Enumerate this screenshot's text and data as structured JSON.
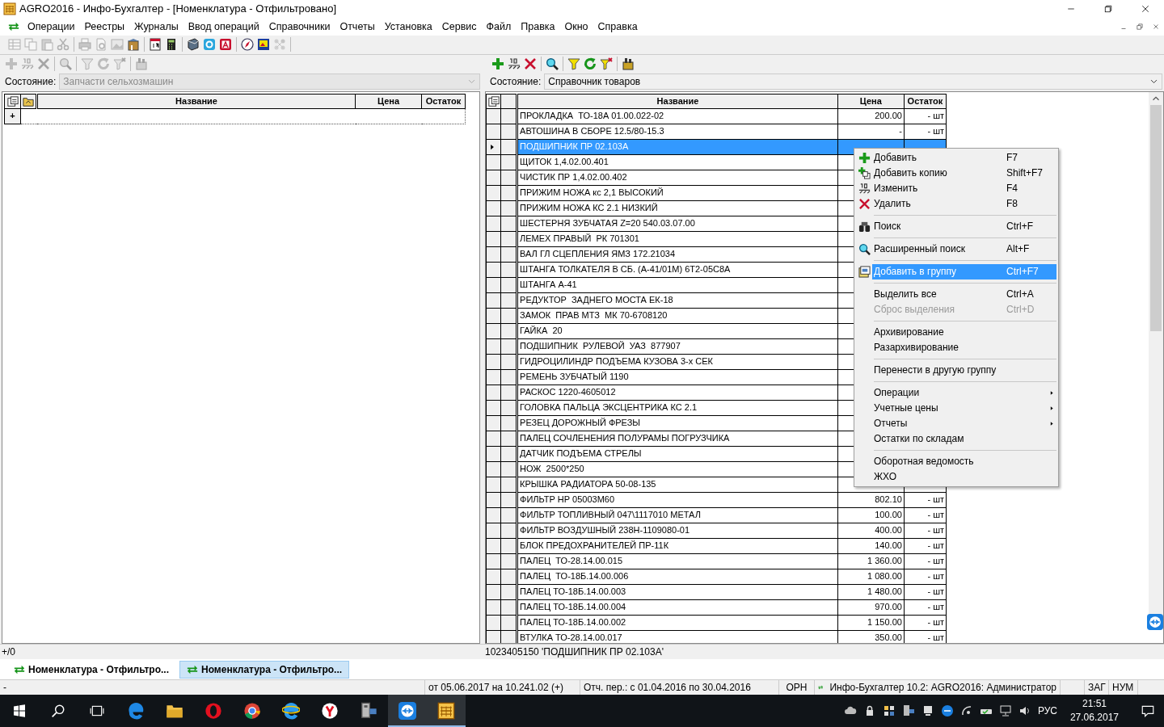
{
  "window": {
    "title": "AGRO2016 - Инфо-Бухгалтер - [Номенклатура - Отфильтровано]"
  },
  "menu": [
    "Операции",
    "Реестры",
    "Журналы",
    "Ввод операций",
    "Справочники",
    "Отчеты",
    "Установка",
    "Сервис",
    "Файл",
    "Правка",
    "Окно",
    "Справка"
  ],
  "left_panel": {
    "toolbar_enabled": false,
    "state_label": "Состояние:",
    "state_value": "Запчасти сельхозмашин",
    "state_disabled": true,
    "columns": [
      "Название",
      "Цена",
      "Остаток"
    ],
    "add_row": "+"
  },
  "right_panel": {
    "toolbar_enabled": true,
    "state_label": "Состояние:",
    "state_value": "Справочник товаров",
    "state_disabled": false,
    "columns": [
      "Название",
      "Цена",
      "Остаток"
    ],
    "rows": [
      {
        "name": "ПРОКЛАДКА  ТО-18А 01.00.022-02",
        "price": "200.00",
        "stock": "- шт",
        "selected": false
      },
      {
        "name": "АВТОШИНА В СБОРЕ 12.5/80-15.3",
        "price": "-",
        "stock": "- шт",
        "selected": false
      },
      {
        "name": "ПОДШИПНИК ПР 02.103А",
        "selected": true
      },
      {
        "name": "ЩИТОК 1,4.02.00.401",
        "selected": false
      },
      {
        "name": "ЧИСТИК ПР 1,4.02.00.402",
        "selected": false
      },
      {
        "name": "ПРИЖИМ НОЖА кс 2,1 ВЫСОКИЙ",
        "selected": false
      },
      {
        "name": "ПРИЖИМ НОЖА КС 2.1 НИЗКИЙ",
        "selected": false
      },
      {
        "name": "ШЕСТЕРНЯ ЗУБЧАТАЯ Z=20 540.03.07.00",
        "selected": false
      },
      {
        "name": "ЛЕМЕХ ПРАВЫЙ  РК 701301",
        "selected": false
      },
      {
        "name": "ВАЛ ГЛ СЦЕПЛЕНИЯ ЯМЗ 172.21034",
        "selected": false
      },
      {
        "name": "ШТАНГА ТОЛКАТЕЛЯ В СБ. (А-41/01М) 6Т2-05С8А",
        "selected": false
      },
      {
        "name": "ШТАНГА А-41",
        "selected": false
      },
      {
        "name": "РЕДУКТОР  ЗАДНЕГО МОСТА ЕК-18",
        "selected": false
      },
      {
        "name": "ЗАМОК  ПРАВ МТЗ  МК 70-6708120",
        "selected": false
      },
      {
        "name": "ГАЙКА  20",
        "selected": false
      },
      {
        "name": "ПОДШИПНИК  РУЛЕВОЙ  УАЗ  877907",
        "selected": false
      },
      {
        "name": "ГИДРОЦИЛИНДР ПОДЪЕМА КУЗОВА 3-х СЕК",
        "selected": false
      },
      {
        "name": "РЕМЕНЬ ЗУБЧАТЫЙ 1190",
        "selected": false
      },
      {
        "name": "РАСКОС 1220-4605012",
        "selected": false
      },
      {
        "name": "ГОЛОВКА ПАЛЬЦА ЭКСЦЕНТРИКА КС 2.1",
        "selected": false
      },
      {
        "name": "РЕЗЕЦ ДОРОЖНЫЙ ФРЕЗЫ",
        "selected": false
      },
      {
        "name": "ПАЛЕЦ СОЧЛЕНЕНИЯ ПОЛУРАМЫ ПОГРУЗЧИКА",
        "selected": false
      },
      {
        "name": "ДАТЧИК ПОДЪЕМА СТРЕЛЫ",
        "selected": false
      },
      {
        "name": "НОЖ  2500*250",
        "selected": false
      },
      {
        "name": "КРЫШКА РАДИАТОРА 50-08-135",
        "selected": false
      },
      {
        "name": "ФИЛЬТР НР 05003М60",
        "price": "802.10",
        "stock": "- шт",
        "selected": false
      },
      {
        "name": "ФИЛЬТР ТОПЛИВНЫЙ 047\\1117010 МЕТАЛ",
        "price": "100.00",
        "stock": "- шт",
        "selected": false
      },
      {
        "name": "ФИЛЬТР ВОЗДУШНЫЙ 238Н-1109080-01",
        "price": "400.00",
        "stock": "- шт",
        "selected": false
      },
      {
        "name": "БЛОК ПРЕДОХРАНИТЕЛЕЙ ПР-11К",
        "price": "140.00",
        "stock": "- шт",
        "selected": false
      },
      {
        "name": "ПАЛЕЦ  ТО-28.14.00.015",
        "price": "1 360.00",
        "stock": "- шт",
        "selected": false
      },
      {
        "name": "ПАЛЕЦ  ТО-18Б.14.00.006",
        "price": "1 080.00",
        "stock": "- шт",
        "selected": false
      },
      {
        "name": "ПАЛЕЦ ТО-18Б.14.00.003",
        "price": "1 480.00",
        "stock": "- шт",
        "selected": false
      },
      {
        "name": "ПАЛЕЦ ТО-18Б.14.00.004",
        "price": "970.00",
        "stock": "- шт",
        "selected": false
      },
      {
        "name": "ПАЛЕЦ ТО-18Б.14.00.002",
        "price": "1 150.00",
        "stock": "- шт",
        "selected": false
      },
      {
        "name": "ВТУЛКА ТО-28.14.00.017",
        "price": "350.00",
        "stock": "- шт",
        "selected": false
      }
    ]
  },
  "context_menu": [
    {
      "kind": "item",
      "label": "Добавить",
      "shortcut": "F7",
      "selected": false,
      "disabled": false,
      "submenu": false
    },
    {
      "kind": "item",
      "label": "Добавить копию",
      "shortcut": "Shift+F7",
      "selected": false,
      "disabled": false,
      "submenu": false
    },
    {
      "kind": "item",
      "label": "Изменить",
      "shortcut": "F4",
      "selected": false,
      "disabled": false,
      "submenu": false
    },
    {
      "kind": "item",
      "label": "Удалить",
      "shortcut": "F8",
      "selected": false,
      "disabled": false,
      "submenu": false
    },
    {
      "kind": "separator"
    },
    {
      "kind": "item",
      "label": "Поиск",
      "shortcut": "Ctrl+F",
      "selected": false,
      "disabled": false,
      "submenu": false
    },
    {
      "kind": "separator"
    },
    {
      "kind": "item",
      "label": "Расширенный поиск",
      "shortcut": "Alt+F",
      "selected": false,
      "disabled": false,
      "submenu": false
    },
    {
      "kind": "separator"
    },
    {
      "kind": "item",
      "label": "Добавить в группу",
      "shortcut": "Ctrl+F7",
      "selected": true,
      "disabled": false,
      "submenu": false
    },
    {
      "kind": "separator"
    },
    {
      "kind": "item",
      "label": "Выделить все",
      "shortcut": "Ctrl+A",
      "selected": false,
      "disabled": false,
      "submenu": false
    },
    {
      "kind": "item",
      "label": "Сброс выделения",
      "shortcut": "Ctrl+D",
      "selected": false,
      "disabled": true,
      "submenu": false
    },
    {
      "kind": "separator"
    },
    {
      "kind": "item",
      "label": "Архивирование",
      "selected": false,
      "disabled": false,
      "submenu": false
    },
    {
      "kind": "item",
      "label": "Разархивирование",
      "selected": false,
      "disabled": false,
      "submenu": false
    },
    {
      "kind": "separator"
    },
    {
      "kind": "item",
      "label": "Перенести в другую группу",
      "selected": false,
      "disabled": false,
      "submenu": false
    },
    {
      "kind": "separator"
    },
    {
      "kind": "item",
      "label": "Операции",
      "selected": false,
      "disabled": false,
      "submenu": true
    },
    {
      "kind": "item",
      "label": "Учетные цены",
      "selected": false,
      "disabled": false,
      "submenu": true
    },
    {
      "kind": "item",
      "label": "Отчеты",
      "selected": false,
      "disabled": false,
      "submenu": true
    },
    {
      "kind": "item",
      "label": "Остатки по складам",
      "selected": false,
      "disabled": false,
      "submenu": false
    },
    {
      "kind": "separator"
    },
    {
      "kind": "item",
      "label": "Оборотная ведомость",
      "selected": false,
      "disabled": false,
      "submenu": false
    },
    {
      "kind": "item",
      "label": "ЖХО",
      "selected": false,
      "disabled": false,
      "submenu": false
    }
  ],
  "info_bar": {
    "count": "+/0",
    "record": "1023405150 'ПОДШИПНИК ПР 02.103А'"
  },
  "tabs": [
    {
      "label": "Номенклатура - Отфильтро...",
      "selected": false
    },
    {
      "label": "Номенклатура - Отфильтро...",
      "selected": true
    }
  ],
  "status_bar": [
    "-",
    "от 05.06.2017 на 10.241.02 (+)",
    "Отч. пер.: с 01.04.2016 по 30.04.2016",
    "ОРН",
    "Инфо-Бухгалтер 10.2: AGRO2016: Администратор",
    "ЗАГ",
    "НУМ"
  ],
  "taskbar": {
    "apps": [
      {
        "running": false
      },
      {
        "running": false
      },
      {
        "running": false
      },
      {
        "running": false
      },
      {
        "running": false
      },
      {
        "running": false
      },
      {
        "running": false
      },
      {
        "running": true
      },
      {
        "running": true
      }
    ],
    "language": "РУС",
    "time": "21:51",
    "date": "27.06.2017"
  }
}
